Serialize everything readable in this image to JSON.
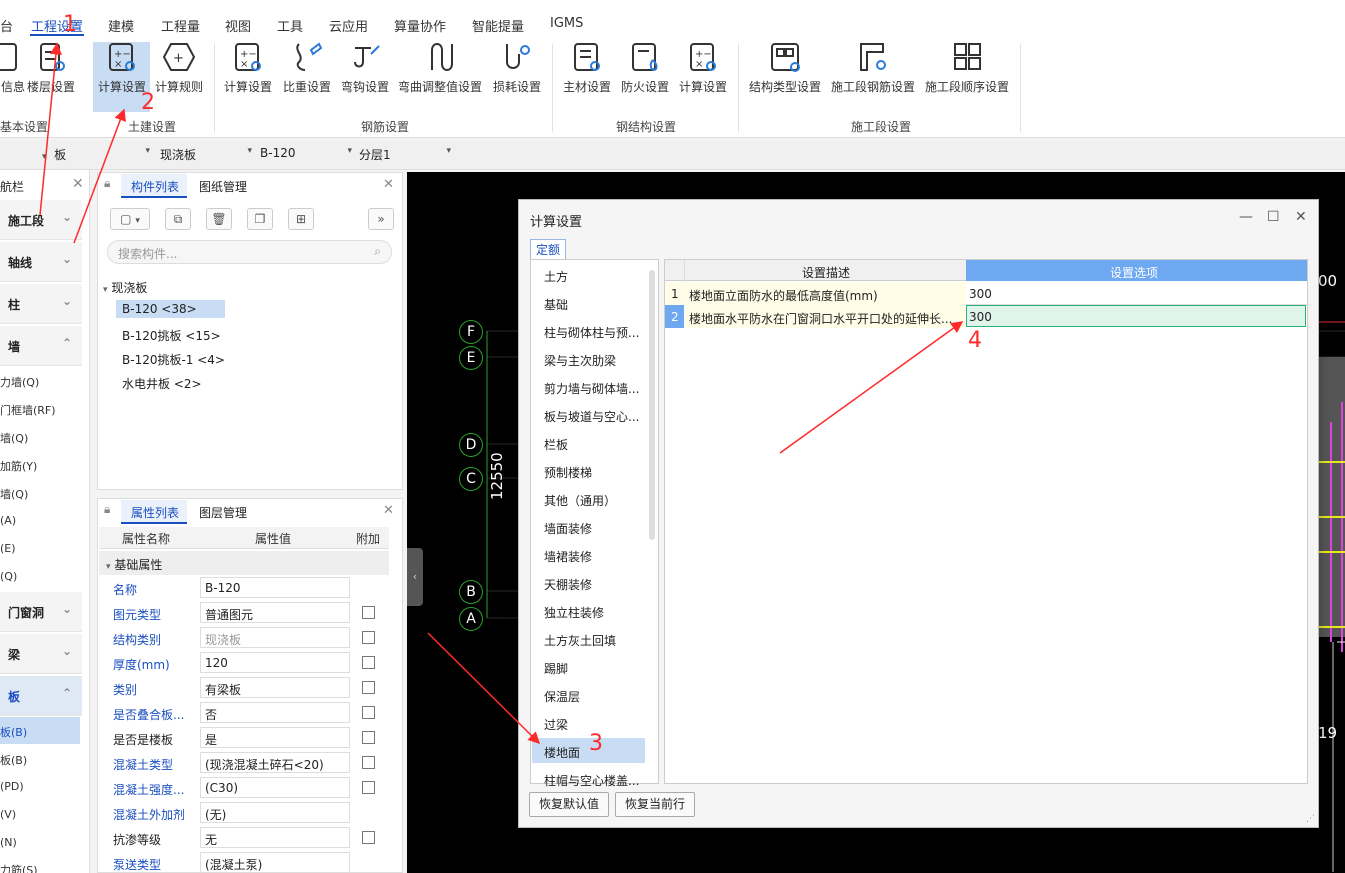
{
  "menu": {
    "items": [
      {
        "label": "台"
      },
      {
        "label": "工程设置"
      },
      {
        "label": "建模"
      },
      {
        "label": "工程量"
      },
      {
        "label": "视图"
      },
      {
        "label": "工具"
      },
      {
        "label": "云应用"
      },
      {
        "label": "算量协作"
      },
      {
        "label": "智能提量"
      },
      {
        "label": "IGMS"
      }
    ]
  },
  "ribbon": {
    "buttons": [
      {
        "label": "信息",
        "icon": "info-icon"
      },
      {
        "label": "楼层设置",
        "icon": "floor-settings-icon"
      },
      {
        "label": "计算设置",
        "icon": "calc-settings-icon"
      },
      {
        "label": "计算规则",
        "icon": "calc-rule-icon"
      },
      {
        "label": "计算设置",
        "icon": "calc-settings-icon"
      },
      {
        "label": "比重设置",
        "icon": "density-icon"
      },
      {
        "label": "弯钩设置",
        "icon": "hook-icon"
      },
      {
        "label": "弯曲调整值设置",
        "icon": "bend-icon"
      },
      {
        "label": "损耗设置",
        "icon": "loss-icon"
      },
      {
        "label": "主材设置",
        "icon": "material-icon"
      },
      {
        "label": "防火设置",
        "icon": "fire-icon"
      },
      {
        "label": "计算设置",
        "icon": "calc-settings-icon"
      },
      {
        "label": "结构类型设置",
        "icon": "structure-type-icon"
      },
      {
        "label": "施工段钢筋设置",
        "icon": "segment-rebar-icon"
      },
      {
        "label": "施工段顺序设置",
        "icon": "segment-order-icon"
      }
    ],
    "groups": [
      "基本设置",
      "土建设置",
      "钢筋设置",
      "钢结构设置",
      "施工段设置"
    ]
  },
  "selectors": [
    "板",
    "现浇板",
    "B-120",
    "分层1"
  ],
  "nav": {
    "title": "航栏",
    "sections": [
      {
        "label": "施工段"
      },
      {
        "label": "轴线"
      },
      {
        "label": "柱"
      },
      {
        "label": "墙"
      },
      {
        "label": "门窗洞"
      },
      {
        "label": "梁"
      },
      {
        "label": "板"
      }
    ],
    "wall_items": [
      "力墙(Q)",
      "门框墙(RF)",
      "墙(Q)",
      "加筋(Y)",
      "墙(Q)",
      "(A)",
      "(E)",
      "(Q)"
    ],
    "slab_items": [
      "板(B)",
      "板(B)",
      "(PD)",
      "(V)",
      "(N)",
      "力筋(S)"
    ]
  },
  "components": {
    "tabs": [
      "构件列表",
      "图纸管理"
    ],
    "search_placeholder": "搜索构件...",
    "root": "现浇板",
    "items": [
      "B-120 <38>",
      "B-120挑板 <15>",
      "B-120挑板-1 <4>",
      "水电井板 <2>"
    ]
  },
  "properties": {
    "tabs": [
      "属性列表",
      "图层管理"
    ],
    "headers": [
      "属性名称",
      "属性值",
      "附加"
    ],
    "group": "基础属性",
    "rows": [
      {
        "name": "名称",
        "value": "B-120"
      },
      {
        "name": "图元类型",
        "value": "普通图元"
      },
      {
        "name": "结构类别",
        "value": "现浇板"
      },
      {
        "name": "厚度(mm)",
        "value": "120"
      },
      {
        "name": "类别",
        "value": "有梁板"
      },
      {
        "name": "是否叠合板...",
        "value": "否"
      },
      {
        "name": "是否是楼板",
        "value": "是"
      },
      {
        "name": "混凝土类型",
        "value": "(现浇混凝土碎石<20)"
      },
      {
        "name": "混凝土强度...",
        "value": "(C30)"
      },
      {
        "name": "混凝土外加剂",
        "value": "(无)"
      },
      {
        "name": "抗渗等级",
        "value": "无"
      },
      {
        "name": "泵送类型",
        "value": "(混凝土泵)"
      }
    ]
  },
  "canvas": {
    "axes": [
      "F",
      "E",
      "D",
      "C",
      "B",
      "A"
    ],
    "dimension": "12550",
    "edge_labels": [
      "00",
      "19"
    ]
  },
  "dialog": {
    "title": "计算设置",
    "tab": "定额",
    "categories": [
      "土方",
      "基础",
      "柱与砌体柱与预...",
      "梁与主次肋梁",
      "剪力墙与砌体墙...",
      "板与坡道与空心...",
      "栏板",
      "预制楼梯",
      "其他（通用）",
      "墙面装修",
      "墙裙装修",
      "天棚装修",
      "独立柱装修",
      "土方灰土回填",
      "踢脚",
      "保温层",
      "过梁",
      "楼地面",
      "柱帽与空心楼盖..."
    ],
    "selected_category": "楼地面",
    "columns": [
      "设置描述",
      "设置选项"
    ],
    "rows": [
      {
        "no": "1",
        "desc": "楼地面立面防水的最低高度值(mm)",
        "value": "300"
      },
      {
        "no": "2",
        "desc": "楼地面水平防水在门窗洞口水平开口处的延伸长...",
        "value": "300"
      }
    ],
    "buttons": [
      "恢复默认值",
      "恢复当前行"
    ]
  },
  "annotations": [
    "1",
    "2",
    "3",
    "4"
  ],
  "colors": {
    "accent": "#1a4fbf",
    "selected": "#c8dcf4",
    "header_blue": "#6ea8f0",
    "annotation": "#ff2a2a"
  }
}
